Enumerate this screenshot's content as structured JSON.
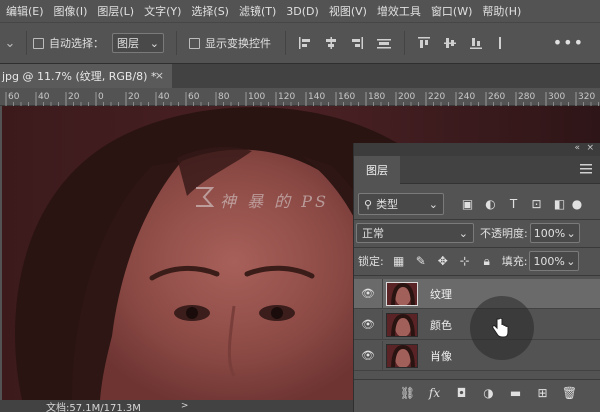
{
  "menu": [
    "编辑(E)",
    "图像(I)",
    "图层(L)",
    "文字(Y)",
    "选择(S)",
    "滤镜(T)",
    "3D(D)",
    "视图(V)",
    "增效工具",
    "窗口(W)",
    "帮助(H)"
  ],
  "options": {
    "auto_select_label": "自动选择：",
    "auto_select_value": "图层",
    "show_transform_label": "显示变换控件",
    "more_label": "•••"
  },
  "document_tab": {
    "title": "jpg @ 11.7% (纹理, RGB/8) *",
    "close": "×"
  },
  "ruler": {
    "ticks": [
      "60",
      "40",
      "20",
      "0",
      "20",
      "40",
      "60",
      "80",
      "100",
      "120",
      "140",
      "160",
      "180",
      "200",
      "220",
      "240",
      "260",
      "280",
      "300",
      "320"
    ]
  },
  "watermark": {
    "text": "神 暴 的 PS"
  },
  "status": {
    "doc_info": "文档:57.1M/171.3M",
    "arrow": ">"
  },
  "layers_panel": {
    "tab_label": "图层",
    "collapse_icon": "«",
    "close_icon": "×",
    "kind_filter": "类型",
    "blend_mode": "正常",
    "opacity_label": "不透明度:",
    "opacity_value": "100%",
    "lock_label": "锁定:",
    "fill_label": "填充:",
    "fill_value": "100%",
    "layers": [
      {
        "name": "纹理",
        "selected": true,
        "visible": true
      },
      {
        "name": "颜色",
        "selected": false,
        "visible": true
      },
      {
        "name": "肖像",
        "selected": false,
        "visible": true
      }
    ],
    "footer_icons": [
      "link-icon",
      "fx-icon",
      "mask-icon",
      "adjustment-icon",
      "group-icon",
      "new-layer-icon",
      "trash-icon"
    ],
    "fx_label": "fx"
  },
  "colors": {
    "ui_gray": "#535353",
    "panel_dark": "#424242",
    "selected_layer": "#6a6a6a"
  }
}
